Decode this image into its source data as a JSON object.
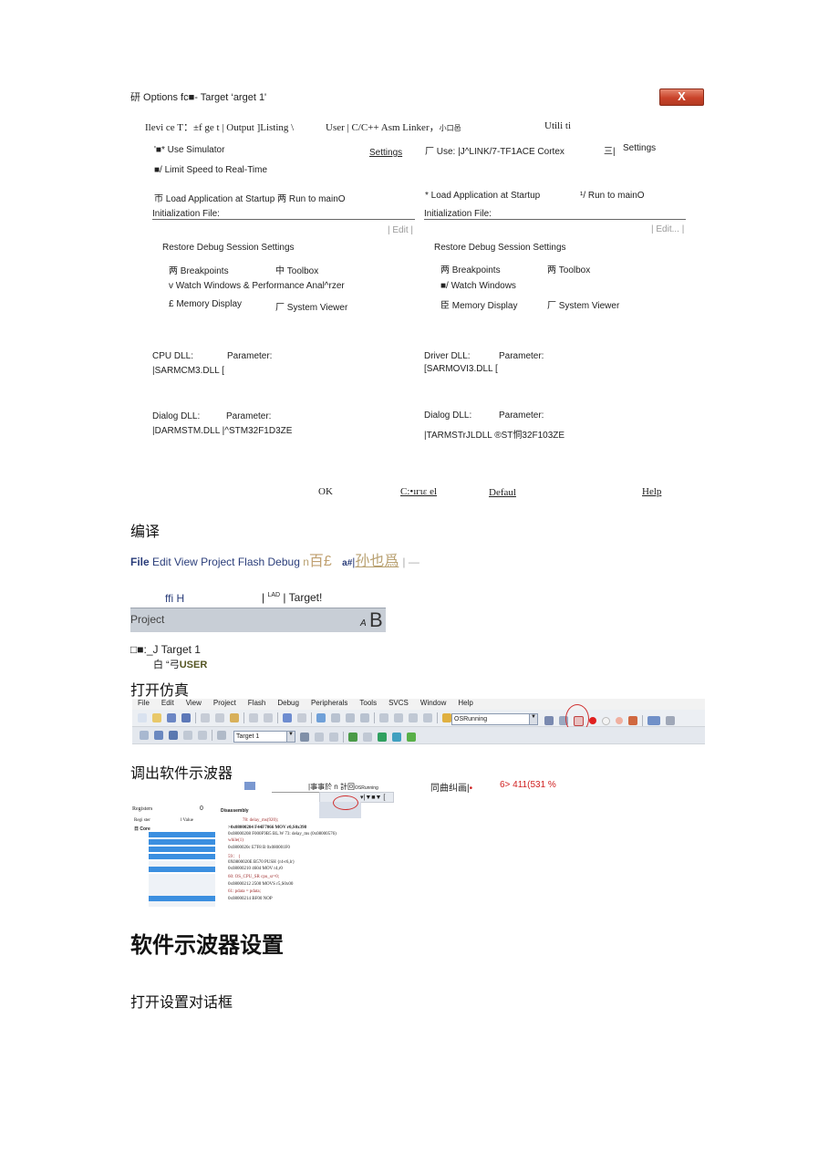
{
  "dialog": {
    "title": "研 Options fc■- Target ‘arget 1'",
    "close_label": "X",
    "tabs": "Ilevi ce T：±f ge t | Output ]Listing \\",
    "tabs2": "User | C/C++ Asm Linker，",
    "tabs2_small": "小口邑",
    "tabs3": "Utili ti",
    "left": {
      "use_simulator": "'■* Use Simulator",
      "settings": "Settings",
      "limit_speed": "■/ Limit Speed to Real-Time",
      "load_app": "帀  Load Application at Startup 两  Run to mainO",
      "init_file": "Initialization File:",
      "edit": "| Edit |",
      "restore": "Restore Debug Session Settings",
      "breakpoints": "两  Breakpoints",
      "toolbox": "中  Toolbox",
      "watch": "v Watch Windows & Performance Anal^rzer",
      "memory": "£ Memory Display",
      "sysviewer": "厂  System Viewer",
      "cpu_dll": "CPU DLL:",
      "param1": "Parameter:",
      "cpu_dll_val": "|SARMCM3.DLL [",
      "dialog_dll": "Dialog DLL:",
      "param2": "Parameter:",
      "dialog_dll_val": "|DARMSTM.DLL |^STM32F1D3ZE"
    },
    "right": {
      "use": "厂 Use: |J^LINK/7-TF1ACE Cortex",
      "settings_icon": "三|",
      "settings": "Settings",
      "load_app": "* Load Application at Startup",
      "run_main": "¹/ Run to mainO",
      "init_file": "Initialization File:",
      "edit": "| Edit... |",
      "restore": "Restore Debug Session Settings",
      "breakpoints": "两  Breakpoints",
      "toolbox": "两  Toolbox",
      "watch": "■/ Watch Windows",
      "memory": "臣  Memory Display",
      "sysviewer": "厂  System Viewer",
      "driver_dll": "Driver DLL:",
      "param1": "Parameter:",
      "driver_dll_val": "[SARMOVI3.DLL [",
      "dialog_dll": "Dialog DLL:",
      "param2": "Parameter:",
      "dialog_dll_val": "|TARMSTrJLDLL ®ST恫32F103ZE"
    },
    "buttons": {
      "ok": "OK",
      "cancel": "C:•ıгιε el",
      "default": "Defaul",
      "help": "Help"
    }
  },
  "sections": {
    "compile": "编译",
    "open_sim": "打开仿真",
    "scope": "调出软件示波器",
    "scope_settings": "软件示波器设置",
    "open_dialog": "打开设置对话框"
  },
  "compile_shot": {
    "menu_bold": "File",
    "menu_rest": " Edit View Project Flash Debug ",
    "menu_n": "n",
    "menu_glyph": "百£",
    "menu_a": "a#",
    "menu_b": "|",
    "menu_glyph2": "孙也爲",
    "menu_tail": "|   —",
    "row2_left": "ffi H",
    "row2_mid": "| ",
    "row2_lad": "LAD",
    "row2_target": " | Target!",
    "project": "Project",
    "project_a": "A",
    "project_b": "B",
    "tree1": "□■:_J Target 1",
    "tree2_pre": "白 “弓",
    "tree2_bold": "USER"
  },
  "sim_shot": {
    "menus": [
      "File",
      "Edit",
      "View",
      "Project",
      "Flash",
      "Debug",
      "Peripherals",
      "Tools",
      "SVCS",
      "Window",
      "Help"
    ],
    "combo1": "OSRunning",
    "combo2": "Target 1"
  },
  "scope_shot": {
    "bar": "|事事於 n 計回",
    "bar_small": "OSRunning",
    "right_text": "同曲纠画|",
    "right_dot": "•",
    "right_nums": "6> 411(531 %",
    "registers": "Registers",
    "reg_zero": "0",
    "reg_col1": "Regi ster",
    "reg_col2": "l Value",
    "core": "日 Core",
    "disassembly": "Disassembly",
    "dis_lines": [
      "78:                  delay_ms(920);",
      ">0x08000204 F44F7066 MOV         r0,S0x398",
      " 0x08000208 F000F9B5 BL.W 73:         delay_ms (0x08000576)",
      "                  while(1)",
      " 0x0800020c E7F8              B          0x080001F0",
      "    59：  {",
      " 0X0800020E B570              PUSH       {r4-r6,lr}",
      "    0x08000210 4604            MOV        r4,r0",
      "       60:        OS_CPU_SR cpu_sr=0;",
      " 0x08000212 2500              MOVS r5,S0x00",
      "       61:        pdata = pdata;",
      " 0x08000214 BF00              NOP"
    ]
  },
  "colors": {
    "close_red": "#c9432a",
    "accent_blue": "#2a3d7a",
    "selection": "#3b8fe0",
    "circle": "#d03030"
  }
}
